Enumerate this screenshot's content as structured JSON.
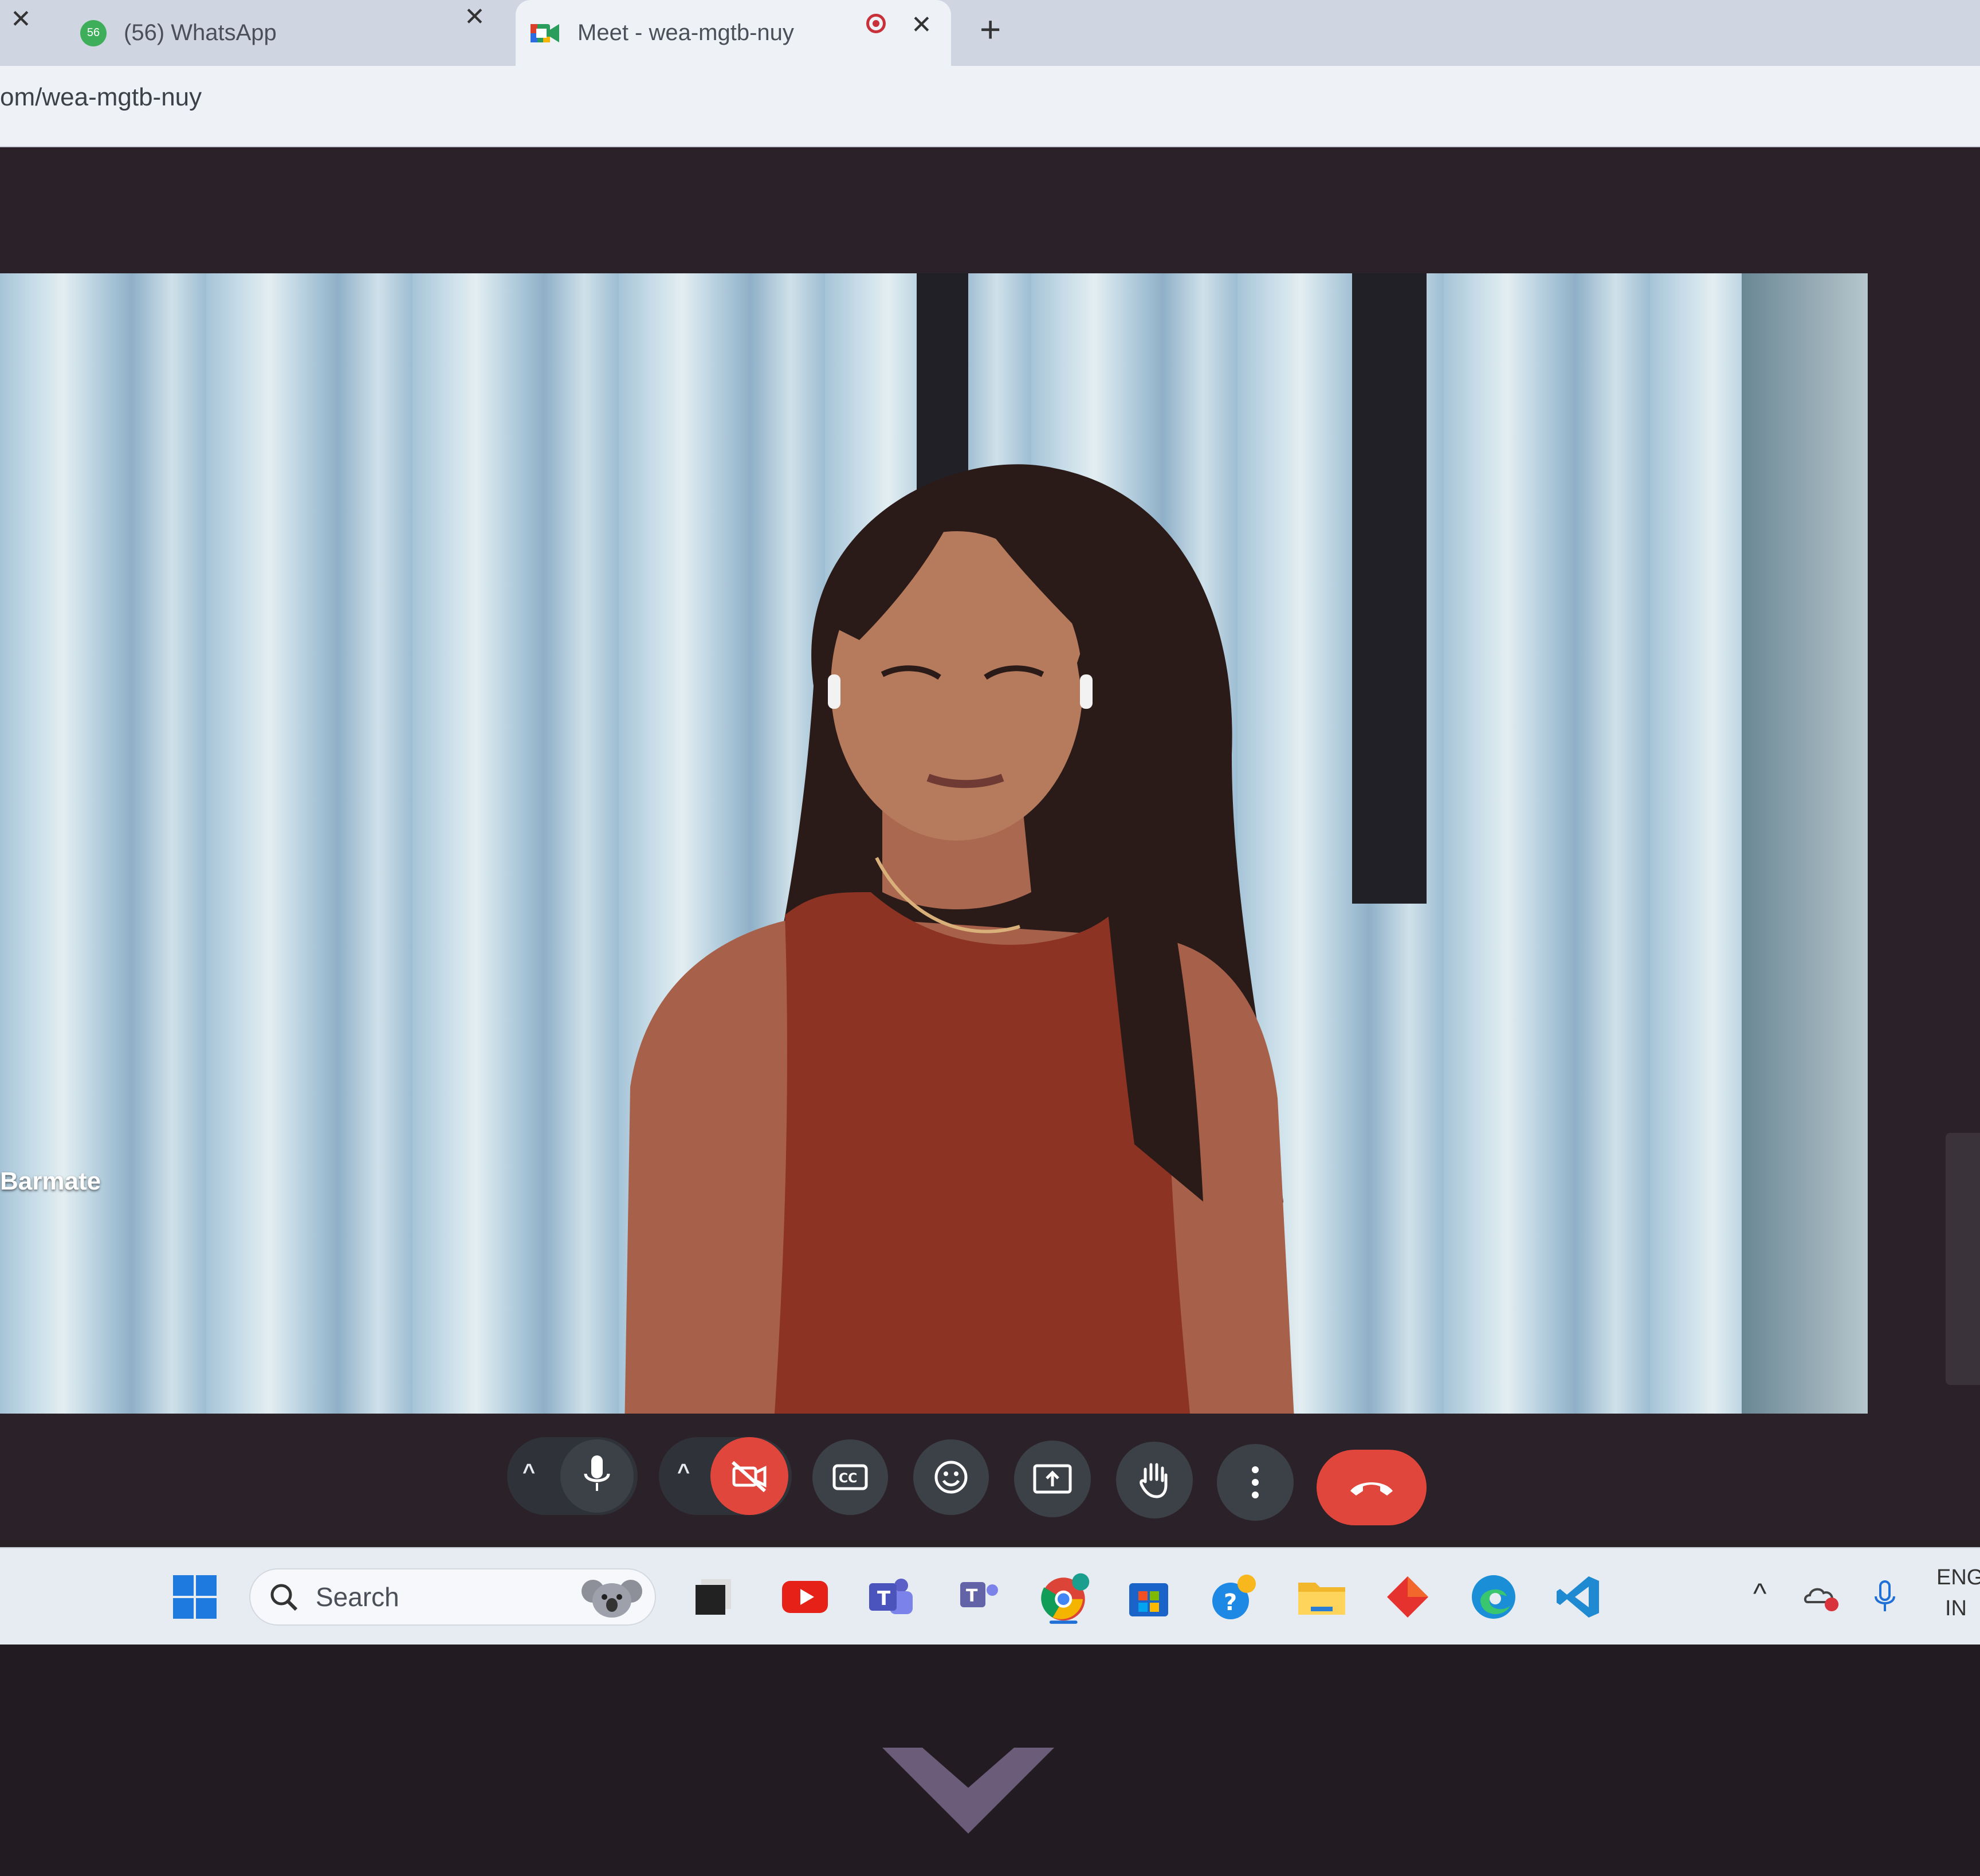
{
  "browser": {
    "tabs": [
      {
        "label": "(56) WhatsApp",
        "badge": "56",
        "icon": "whatsapp-icon"
      },
      {
        "label": "Meet - wea-mgtb-nuy",
        "icon": "google-meet-icon",
        "recording": true
      }
    ],
    "new_tab_symbol": "+",
    "close_symbol": "✕",
    "url": "om/wea-mgtb-nuy"
  },
  "meet": {
    "participant_name": "Barmate",
    "controls": [
      {
        "name": "mic-options",
        "icon": "chevron-up-icon"
      },
      {
        "name": "microphone",
        "icon": "microphone-icon",
        "state": "on"
      },
      {
        "name": "camera-options",
        "icon": "chevron-up-icon"
      },
      {
        "name": "camera",
        "icon": "camera-off-icon",
        "state": "off"
      },
      {
        "name": "captions",
        "icon": "closed-captions-icon"
      },
      {
        "name": "reactions",
        "icon": "emoji-icon"
      },
      {
        "name": "present",
        "icon": "present-screen-icon"
      },
      {
        "name": "raise-hand",
        "icon": "hand-icon"
      },
      {
        "name": "more-options",
        "icon": "more-vertical-icon"
      },
      {
        "name": "leave-call",
        "icon": "hang-up-icon"
      }
    ],
    "colors": {
      "danger": "#e0463c",
      "control_bg": "#3c4047",
      "meeting_bg": "#2b2128"
    }
  },
  "taskbar": {
    "search_placeholder": "Search",
    "apps": [
      "start-icon",
      "search-icon",
      "koala-icon",
      "app-l-icon",
      "youtube-icon",
      "teams-icon",
      "teams-classic-icon",
      "chrome-icon",
      "store-icon",
      "help-icon",
      "file-explorer-icon",
      "diamond-app-icon",
      "edge-icon",
      "vscode-icon"
    ],
    "tray": {
      "language_line1": "ENG",
      "language_line2": "IN"
    }
  }
}
